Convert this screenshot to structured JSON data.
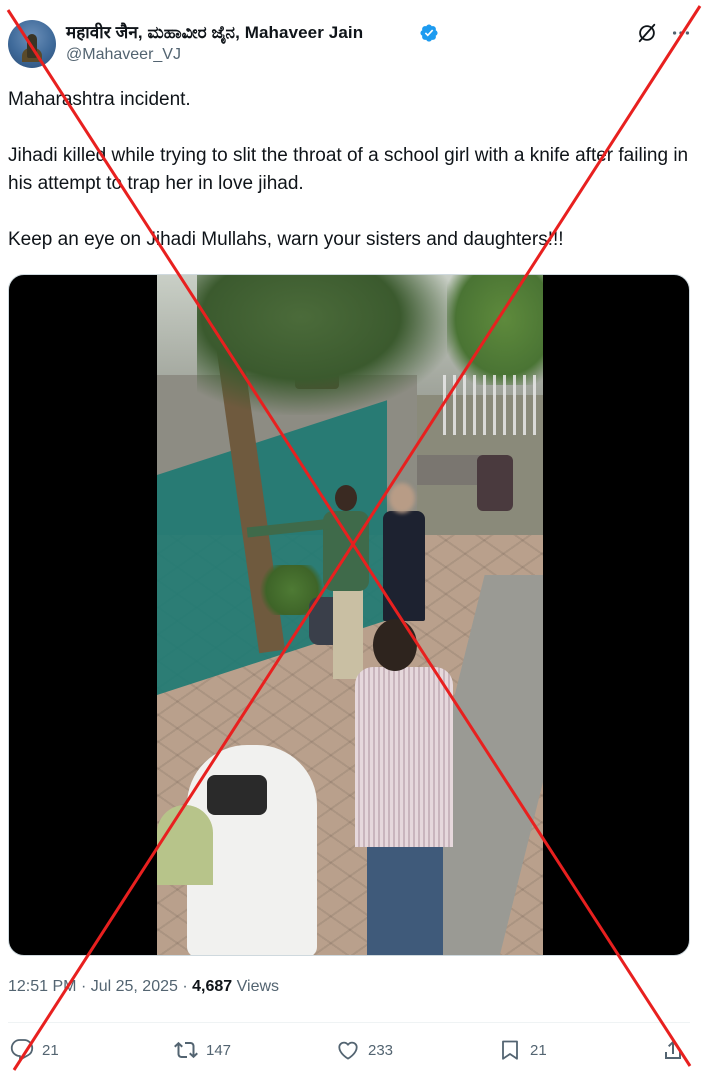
{
  "author": {
    "display_name": "महावीर जैन, ಮಹಾವೀರ ಜೈನ, Mahaveer Jain",
    "handle": "@Mahaveer_VJ",
    "verified": true,
    "verified_color": "#1d9bf0"
  },
  "tweet": {
    "paragraphs": [
      "Maharashtra incident.",
      "Jihadi killed while trying to slit the throat of a school girl with a knife after failing in his attempt to trap her in love jihad.",
      "Keep an eye on Jihadi Mullahs, warn your sisters and daughters!!!"
    ]
  },
  "media": {
    "type": "video-still"
  },
  "meta": {
    "time": "12:51 PM",
    "separator": "·",
    "date": "Jul 25, 2025",
    "views_count": "4,687",
    "views_label": "Views"
  },
  "actions": {
    "replies": "21",
    "reposts": "147",
    "likes": "233",
    "bookmarks": "21"
  },
  "overlay": {
    "cross_color": "#e8201f"
  }
}
